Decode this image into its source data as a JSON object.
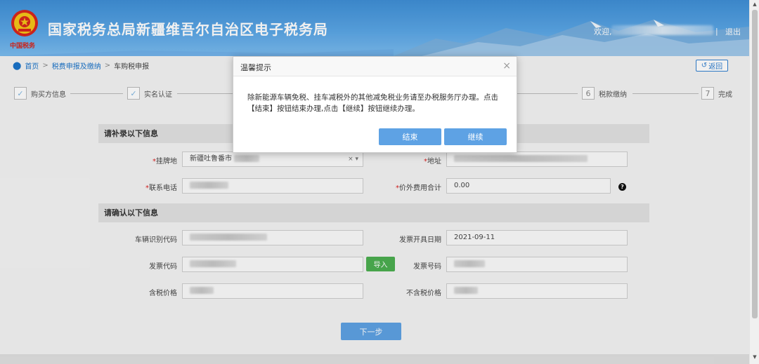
{
  "header": {
    "emblem_caption": "中国税务",
    "title": "国家税务总局新疆维吾尔自治区电子税务局",
    "welcome": "欢迎,",
    "separator": "|",
    "logout": "退出"
  },
  "breadcrumb": {
    "home": "首页",
    "level2": "税费申报及缴纳",
    "current": "车购税申报",
    "sep": ">"
  },
  "back_button": "返回",
  "steps": [
    {
      "label": "购买方信息",
      "marker": "✓"
    },
    {
      "label": "实名认证",
      "marker": "✓"
    },
    {
      "label": "税款缴纳",
      "marker": "6"
    },
    {
      "label": "完成",
      "marker": "7"
    }
  ],
  "sections": {
    "supplement": "请补录以下信息",
    "confirm": "请确认以下信息"
  },
  "form": {
    "plate_location_label": "挂牌地",
    "plate_location_value": "新疆吐鲁番市",
    "plate_location_icons": "× ▾",
    "address_label": "地址",
    "phone_label": "联系电话",
    "extra_fee_label": "价外费用合计",
    "extra_fee_value": "0.00",
    "help_glyph": "?",
    "vin_label": "车辆识别代码",
    "invoice_date_label": "发票开具日期",
    "invoice_date_value": "2021-09-11",
    "invoice_code_label": "发票代码",
    "import_button": "导入",
    "invoice_number_label": "发票号码",
    "tax_incl_label": "含税价格",
    "tax_excl_label": "不含税价格",
    "required_mark": "*"
  },
  "next_button": "下一步",
  "modal": {
    "title": "温馨提示",
    "close": "×",
    "message": "除新能源车辆免税、挂车减税外的其他减免税业务请至办税服务厅办理。点击【结束】按钮结束办理,点击【继续】按钮继续办理。",
    "end_button": "结束",
    "continue_button": "继续"
  },
  "scrollbar": {
    "up": "▲",
    "down": "▼"
  },
  "colors": {
    "header_blue": "#4a9ae0",
    "primary_button": "#5ea2e4",
    "import_green": "#4caf50",
    "link_blue": "#1a73c9",
    "required_red": "#d22222"
  }
}
